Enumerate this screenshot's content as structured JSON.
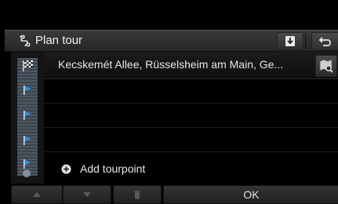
{
  "header": {
    "title": "Plan tour"
  },
  "route": {
    "destination": "Kecskemét Allee, Rüsselsheim am Main, Ge...",
    "add_label": "Add tourpoint"
  },
  "bottom": {
    "ok_label": "OK"
  },
  "icons": {
    "tour": "route-icon",
    "save": "save-download-icon",
    "back": "back-arrow-icon",
    "map_search": "map-search-icon",
    "finish": "checkered-flag-icon",
    "waypoint": "blue-flag-icon",
    "add": "plus-circle-icon",
    "up": "arrow-up-icon",
    "down": "arrow-down-icon",
    "delete": "trash-icon"
  },
  "colors": {
    "waypoint_flag": "#2f8fd8",
    "background": "#000000",
    "header": "#303030"
  }
}
